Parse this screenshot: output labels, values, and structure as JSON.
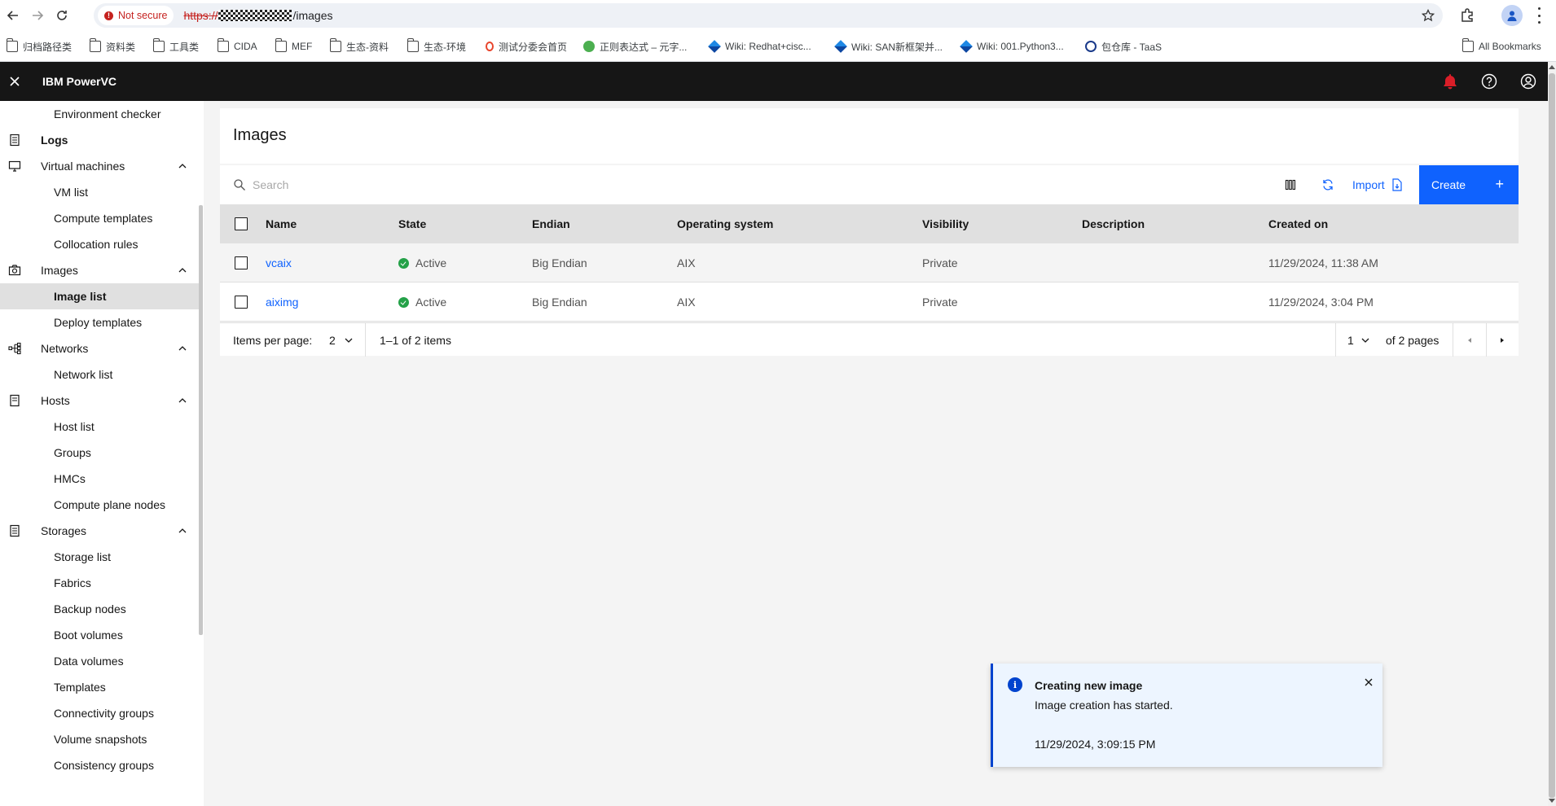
{
  "browser": {
    "security_label": "Not secure",
    "url_scheme": "https://",
    "url_path": "/images",
    "bookmarks": [
      {
        "label": "归档路径类",
        "icon": "folder-icon"
      },
      {
        "label": "资料类",
        "icon": "folder-icon"
      },
      {
        "label": "工具类",
        "icon": "folder-icon"
      },
      {
        "label": "CIDA",
        "icon": "folder-icon"
      },
      {
        "label": "MEF",
        "icon": "folder-icon"
      },
      {
        "label": "生态-资料",
        "icon": "folder-icon"
      },
      {
        "label": "生态-环境",
        "icon": "folder-icon"
      },
      {
        "label": "测试分委会首页",
        "icon": "site-icon"
      },
      {
        "label": "正则表达式 – 元字...",
        "icon": "site-icon"
      },
      {
        "label": "Wiki: Redhat+cisc...",
        "icon": "wiki-icon"
      },
      {
        "label": "Wiki: SAN新框架并...",
        "icon": "wiki-icon"
      },
      {
        "label": "Wiki: 001.Python3...",
        "icon": "wiki-icon"
      },
      {
        "label": "包仓库 - TaaS",
        "icon": "site-icon"
      }
    ],
    "all_bookmarks_label": "All Bookmarks"
  },
  "header": {
    "app_name": "IBM PowerVC"
  },
  "sidebar": {
    "items": [
      {
        "label": "Environment checker",
        "type": "sub"
      },
      {
        "label": "Logs",
        "type": "group",
        "icon": "logs-icon"
      },
      {
        "label": "Virtual machines",
        "type": "group",
        "icon": "monitor-icon",
        "expanded": true
      },
      {
        "label": "VM list",
        "type": "sub"
      },
      {
        "label": "Compute templates",
        "type": "sub"
      },
      {
        "label": "Collocation rules",
        "type": "sub"
      },
      {
        "label": "Images",
        "type": "group",
        "icon": "camera-icon",
        "expanded": true
      },
      {
        "label": "Image list",
        "type": "sub",
        "active": true
      },
      {
        "label": "Deploy templates",
        "type": "sub"
      },
      {
        "label": "Networks",
        "type": "group",
        "icon": "network-icon",
        "expanded": true
      },
      {
        "label": "Network list",
        "type": "sub"
      },
      {
        "label": "Hosts",
        "type": "group",
        "icon": "host-icon",
        "expanded": true
      },
      {
        "label": "Host list",
        "type": "sub"
      },
      {
        "label": "Groups",
        "type": "sub"
      },
      {
        "label": "HMCs",
        "type": "sub"
      },
      {
        "label": "Compute plane nodes",
        "type": "sub"
      },
      {
        "label": "Storages",
        "type": "group",
        "icon": "storage-icon",
        "expanded": true
      },
      {
        "label": "Storage list",
        "type": "sub"
      },
      {
        "label": "Fabrics",
        "type": "sub"
      },
      {
        "label": "Backup nodes",
        "type": "sub"
      },
      {
        "label": "Boot volumes",
        "type": "sub"
      },
      {
        "label": "Data volumes",
        "type": "sub"
      },
      {
        "label": "Templates",
        "type": "sub"
      },
      {
        "label": "Connectivity groups",
        "type": "sub"
      },
      {
        "label": "Volume snapshots",
        "type": "sub"
      },
      {
        "label": "Consistency groups",
        "type": "sub"
      }
    ]
  },
  "main": {
    "title": "Images",
    "search_placeholder": "Search",
    "import_label": "Import",
    "create_label": "Create",
    "columns": [
      "Name",
      "State",
      "Endian",
      "Operating system",
      "Visibility",
      "Description",
      "Created on"
    ],
    "rows": [
      {
        "name": "vcaix",
        "state": "Active",
        "endian": "Big Endian",
        "os": "AIX",
        "visibility": "Private",
        "description": "",
        "created": "11/29/2024, 11:38 AM"
      },
      {
        "name": "aiximg",
        "state": "Active",
        "endian": "Big Endian",
        "os": "AIX",
        "visibility": "Private",
        "description": "",
        "created": "11/29/2024, 3:04 PM"
      }
    ],
    "pagination": {
      "items_per_page_label": "Items per page:",
      "items_per_page": "2",
      "range": "1–1 of 2 items",
      "page": "1",
      "of_pages": "of 2 pages"
    }
  },
  "toast": {
    "title": "Creating new image",
    "subtitle": "Image creation has started.",
    "timestamp": "11/29/2024, 3:09:15 PM"
  },
  "colors": {
    "primary": "#0f62fe",
    "header_bg": "#161616",
    "active_status": "#24a148",
    "notification": "#da1e28"
  }
}
